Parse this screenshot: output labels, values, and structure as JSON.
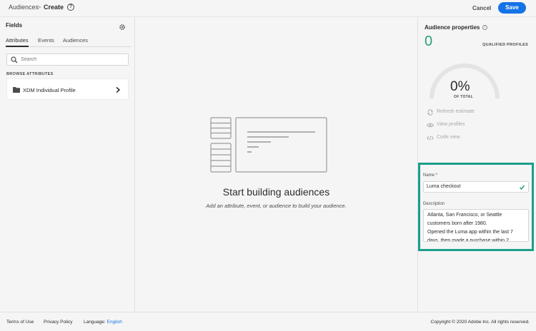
{
  "header": {
    "breadcrumb_parent": "Audiences",
    "breadcrumb_separator": ">",
    "breadcrumb_current": "Create",
    "help_icon": "?",
    "cancel_label": "Cancel",
    "save_label": "Save",
    "accent_color": "#1473e6"
  },
  "left_panel": {
    "title": "Fields",
    "tabs": [
      {
        "label": "Attributes",
        "active": true
      },
      {
        "label": "Events",
        "active": false
      },
      {
        "label": "Audiences",
        "active": false
      }
    ],
    "search": {
      "placeholder": "Search"
    },
    "browse_heading": "BROWSE ATTRIBUTES",
    "items": [
      {
        "label": "XDM Individual Profile",
        "icon": "folder-icon"
      }
    ]
  },
  "canvas": {
    "title": "Start building audiences",
    "subtitle": "Add an attribute, event, or audience to build your audience."
  },
  "properties": {
    "title": "Audience properties",
    "qualified_count": "0",
    "qualified_label": "QUALIFIED PROFILES",
    "percent": "0%",
    "percent_label": "OF TOTAL",
    "count_color": "#2d9d78",
    "actions": [
      {
        "label": "Refresh estimate",
        "icon": "refresh-icon"
      },
      {
        "label": "View profiles",
        "icon": "eye-icon"
      },
      {
        "label": "Code view",
        "icon": "code-icon"
      }
    ],
    "name_label": "Name *",
    "name_value": "Luma checkout",
    "description_label": "Description",
    "description_value": "Atlanta, San Francisco, or Seattle customers born after 1980.\nOpened the Luma app within the last 7 days, then made a purchase within 2",
    "highlight_color": "#1a9e8a"
  },
  "footer": {
    "terms": "Terms of Use",
    "privacy": "Privacy Policy",
    "language_label": "Language:",
    "language_value": "English",
    "copyright": "Copyright © 2020 Adobe Inc. All rights reserved."
  }
}
